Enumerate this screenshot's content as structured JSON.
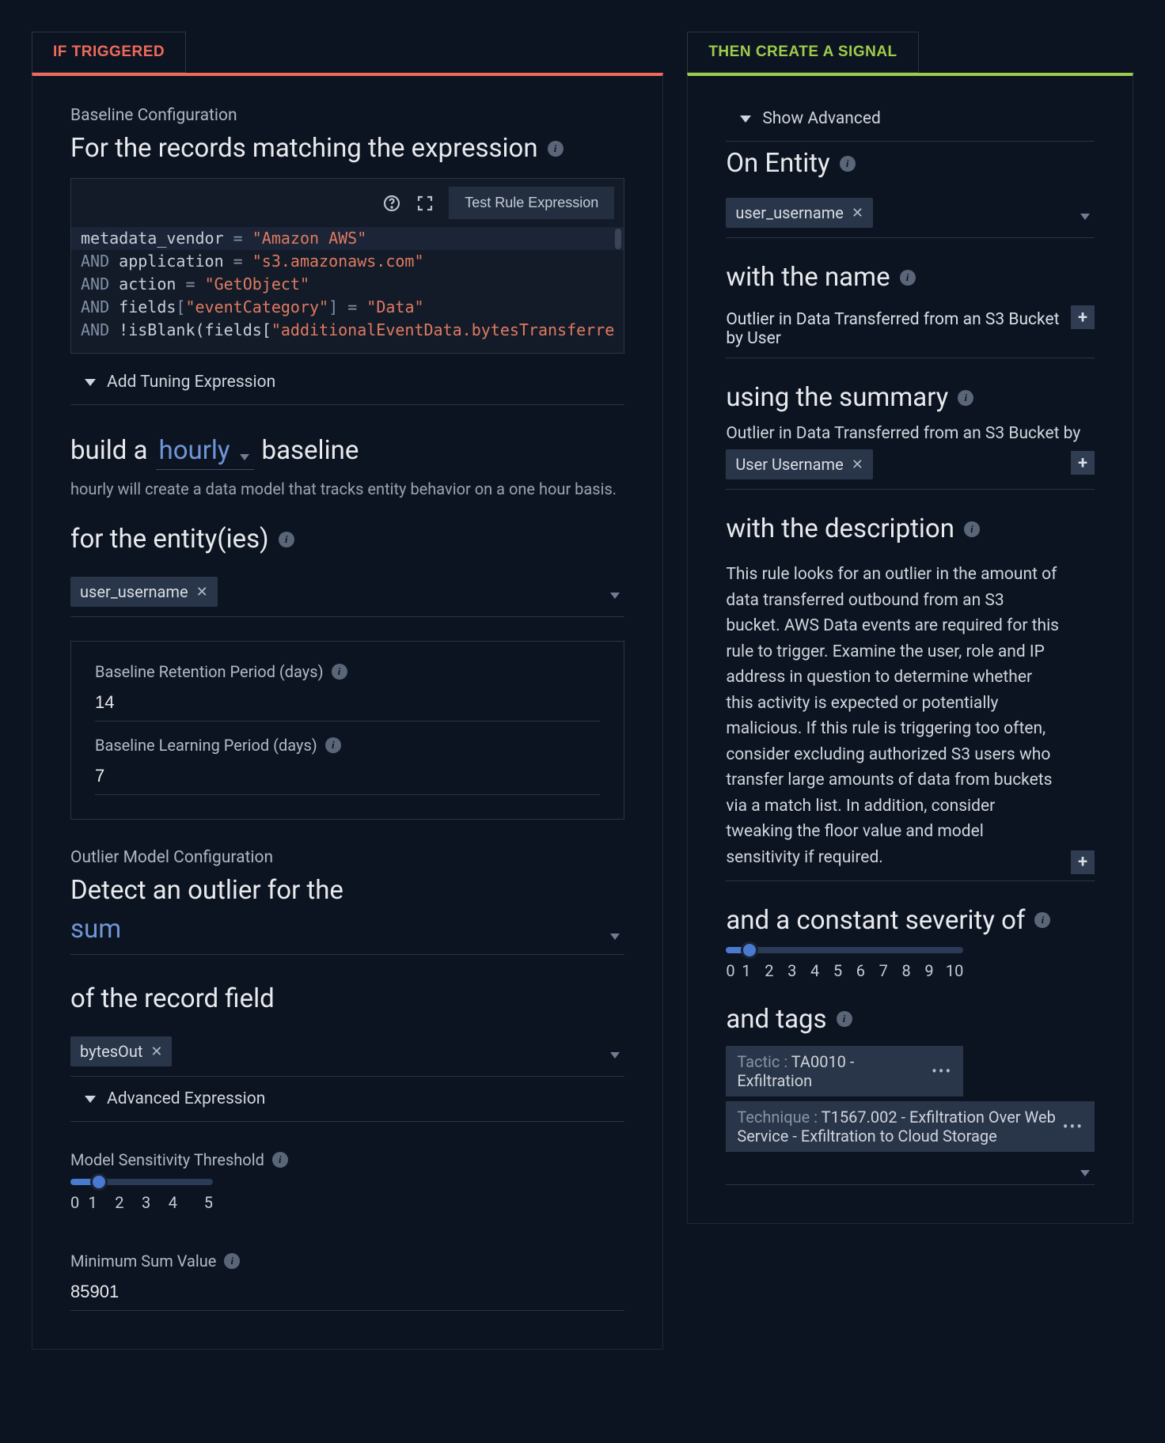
{
  "tabs": {
    "left": "IF TRIGGERED",
    "right": "THEN CREATE A SIGNAL"
  },
  "left": {
    "section1_label": "Baseline Configuration",
    "heading1": "For the records matching the expression",
    "toolbar": {
      "test_btn": "Test Rule Expression"
    },
    "expression_tokens": {
      "l1a": "metadata_vendor",
      "l1b": "=",
      "l1c": "\"Amazon AWS\"",
      "l2a": "AND",
      "l2b": "application",
      "l2c": "=",
      "l2d": "\"s3.amazonaws.com\"",
      "l3a": "AND",
      "l3b": "action",
      "l3c": "=",
      "l3d": "\"GetObject\"",
      "l4a": "AND",
      "l4b": "fields",
      "l4c": "[",
      "l4d": "\"eventCategory\"",
      "l4e": "]",
      "l4f": "=",
      "l4g": "\"Data\"",
      "l5a": "AND",
      "l5b": "!isBlank(fields[",
      "l5c": "\"additionalEventData.bytesTransferre"
    },
    "add_tuning": "Add Tuning Expression",
    "build_a": "build a",
    "interval": "hourly",
    "baseline_word": "baseline",
    "interval_hint": "hourly will create a data model that tracks entity behavior on a one hour basis.",
    "for_entities": "for the entity(ies)",
    "entity_chip": "user_username",
    "retention_label": "Baseline Retention Period (days)",
    "retention_value": "14",
    "learning_label": "Baseline Learning Period (days)",
    "learning_value": "7",
    "section2_label": "Outlier Model Configuration",
    "heading2": "Detect an outlier for the",
    "agg": "sum",
    "heading3": "of the record field",
    "field_chip": "bytesOut",
    "adv_expr": "Advanced Expression",
    "model_sens_label": "Model Sensitivity Threshold",
    "model_sens_value": 1,
    "model_sens_ticks": [
      "0",
      "1",
      "2",
      "3",
      "4",
      "5"
    ],
    "min_sum_label": "Minimum Sum Value",
    "min_sum_value": "85901"
  },
  "right": {
    "show_advanced": "Show Advanced",
    "on_entity": "On Entity",
    "entity_chip": "user_username",
    "with_name": "with the name",
    "name_value": "Outlier in Data Transferred from an S3 Bucket by User",
    "using_summary": "using the summary",
    "summary_prefix": "Outlier in Data Transferred from an S3 Bucket by",
    "summary_chip": "User Username",
    "with_description": "with the description",
    "description": "This rule looks for an outlier in the amount of data transferred outbound from an S3 bucket. AWS Data events are required for this rule to trigger. Examine the user, role and IP address in question to determine whether this activity is expected or potentially malicious. If this rule is triggering too often, consider excluding authorized S3 users who transfer large amounts of data from buckets via a match list. In addition, consider tweaking the floor value and model sensitivity if required.",
    "severity_heading": "and a constant severity of",
    "severity_value": 1,
    "severity_ticks": [
      "0",
      "1",
      "2",
      "3",
      "4",
      "5",
      "6",
      "7",
      "8",
      "9",
      "10"
    ],
    "tags_heading": "and tags",
    "tag1_prefix": "Tactic :",
    "tag1_value": "TA0010 - Exfiltration",
    "tag2_prefix": "Technique :",
    "tag2_value": "T1567.002 - Exfiltration Over Web Service - Exfiltration to Cloud Storage"
  }
}
